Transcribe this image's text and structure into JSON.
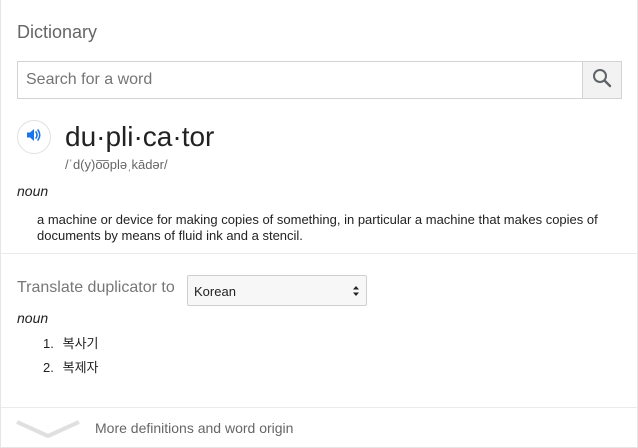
{
  "dictionary": {
    "title": "Dictionary",
    "search": {
      "placeholder": "Search for a word",
      "value": "",
      "button_icon": "magnifier-icon"
    },
    "entry": {
      "speaker_icon": "speaker-icon",
      "headword": "du·pli·ca·tor",
      "phonetic": "/ˈd(y)o͞opləˌkādər/",
      "part_of_speech": "noun",
      "definition": "a machine or device for making copies of something, in particular a machine that makes copies of documents by means of fluid ink and a stencil."
    },
    "translate": {
      "label": "Translate duplicator to",
      "selected_language": "Korean",
      "part_of_speech": "noun",
      "translations": [
        {
          "number": "1.",
          "text": "복사기"
        },
        {
          "number": "2.",
          "text": "복제자"
        }
      ]
    },
    "more": {
      "label": "More definitions and word origin",
      "icon": "chevron-down-icon"
    }
  }
}
